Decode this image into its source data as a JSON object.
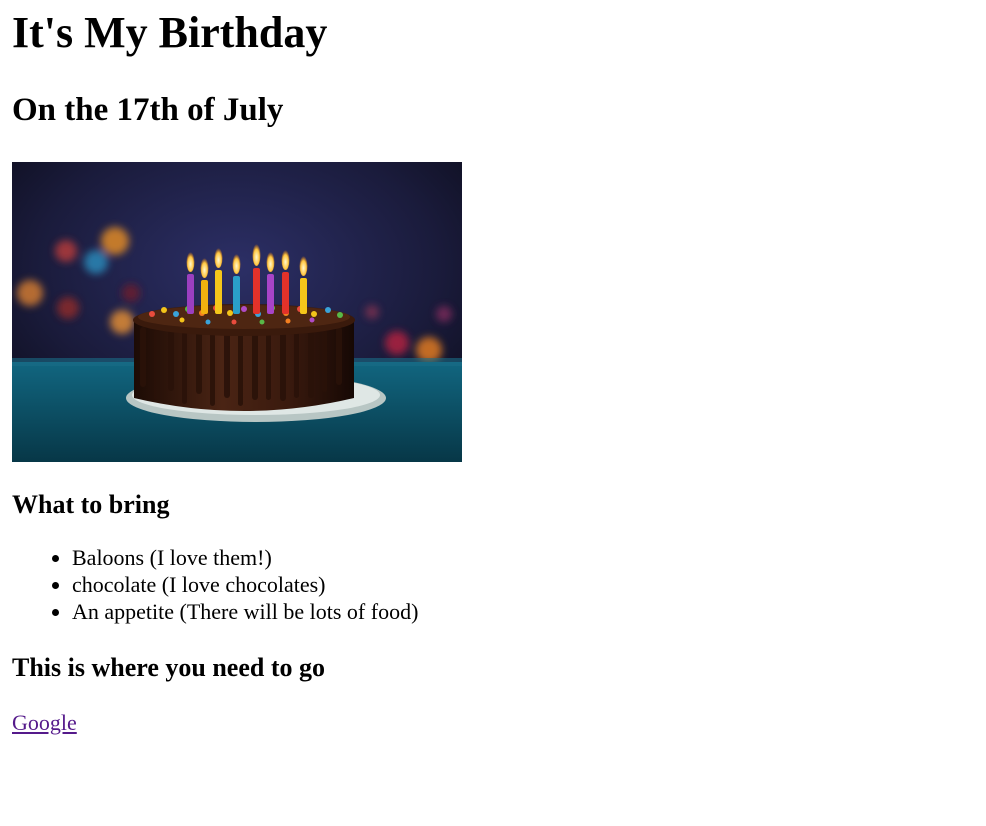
{
  "title": "It's My Birthday",
  "subtitle": "On the 17th of July",
  "image": {
    "subject": "birthday-cake-with-lit-candles",
    "colors": {
      "background_dark": "#1b1c3c",
      "table_teal": "#0f5c73",
      "chocolate": "#3a1a0e",
      "plate": "#cfd8d6"
    }
  },
  "bring": {
    "heading": "What to bring",
    "items": [
      "Baloons (I love them!)",
      "chocolate (I love chocolates)",
      "An appetite (There will be lots of food)"
    ]
  },
  "directions": {
    "heading": "This is where you need to go",
    "link_label": "Google"
  }
}
